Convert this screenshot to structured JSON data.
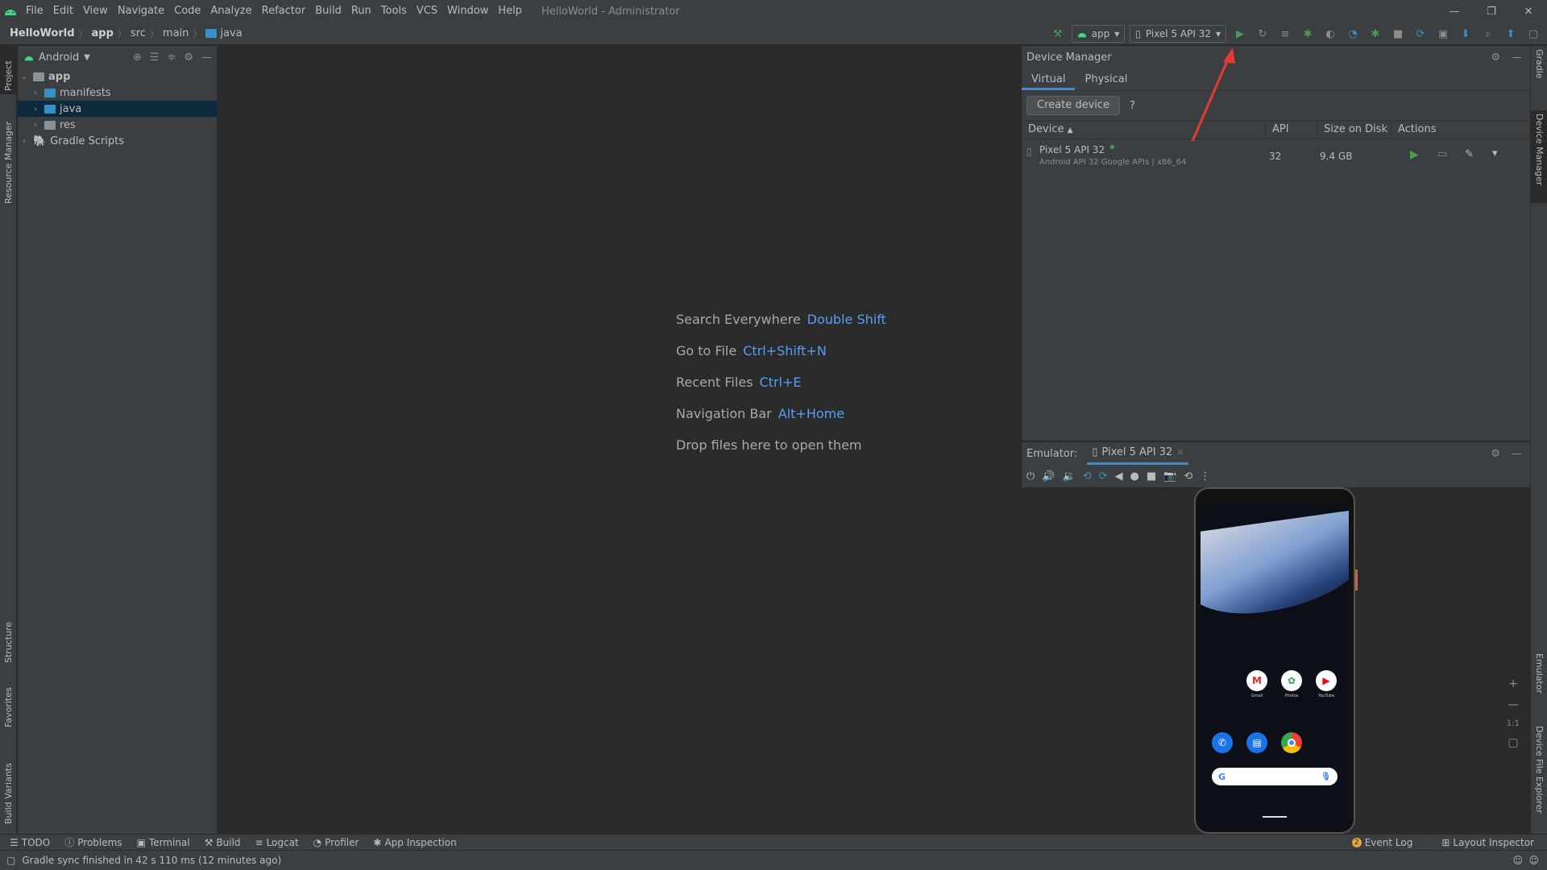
{
  "window": {
    "title": "HelloWorld - Administrator",
    "controls": [
      "—",
      "❐",
      "✕"
    ]
  },
  "menu": [
    "File",
    "Edit",
    "View",
    "Navigate",
    "Code",
    "Analyze",
    "Refactor",
    "Build",
    "Run",
    "Tools",
    "VCS",
    "Window",
    "Help"
  ],
  "breadcrumb": [
    "HelloWorld",
    "app",
    "src",
    "main",
    "java"
  ],
  "toolbar": {
    "run_config": "app",
    "device": "Pixel 5 API 32"
  },
  "left_tabs": [
    "Project",
    "Resource Manager",
    "Structure",
    "Favorites",
    "Build Variants"
  ],
  "right_tabs": [
    "Gradle",
    "Device Manager",
    "Emulator",
    "Device File Explorer"
  ],
  "project": {
    "view": "Android",
    "tree": [
      {
        "label": "app",
        "level": 0,
        "expanded": true
      },
      {
        "label": "manifests",
        "level": 1
      },
      {
        "label": "java",
        "level": 1,
        "selected": true
      },
      {
        "label": "res",
        "level": 1
      },
      {
        "label": "Gradle Scripts",
        "level": 0
      }
    ]
  },
  "editor_hints": [
    {
      "text": "Search Everywhere",
      "key": "Double Shift"
    },
    {
      "text": "Go to File",
      "key": "Ctrl+Shift+N"
    },
    {
      "text": "Recent Files",
      "key": "Ctrl+E"
    },
    {
      "text": "Navigation Bar",
      "key": "Alt+Home"
    },
    {
      "text": "Drop files here to open them",
      "key": ""
    }
  ],
  "device_manager": {
    "title": "Device Manager",
    "tabs": [
      "Virtual",
      "Physical"
    ],
    "create_button": "Create device",
    "help": "?",
    "columns": [
      "Device",
      "API",
      "Size on Disk",
      "Actions"
    ],
    "devices": [
      {
        "name": "Pixel 5 API 32",
        "detail": "Android API 32 Google APIs | x86_64",
        "api": "32",
        "size": "9.4 GB"
      }
    ]
  },
  "emulator": {
    "label": "Emulator:",
    "tab": "Pixel 5 API 32",
    "zoom_label": "1:1",
    "apps": [
      "Gmail",
      "Photos",
      "YouTube"
    ]
  },
  "bottom_tools": [
    "TODO",
    "Problems",
    "Terminal",
    "Build",
    "Logcat",
    "Profiler",
    "App Inspection"
  ],
  "bottom_right": [
    "Event Log",
    "Layout Inspector"
  ],
  "event_log_count": "2",
  "status": "Gradle sync finished in 42 s 110 ms (12 minutes ago)",
  "colors": {
    "accent": "#4a88c7",
    "run_green": "#499c54",
    "link_blue": "#589df6",
    "annotation_red": "#e53935"
  }
}
